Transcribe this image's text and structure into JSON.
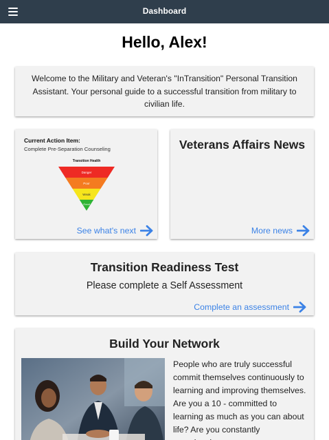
{
  "header": {
    "title": "Dashboard",
    "menu_icon": "hamburger-menu-icon"
  },
  "greeting": "Hello, Alex!",
  "welcome": {
    "text": "Welcome to the Military and Veteran's \"InTransition\" Personal Transition Assistant. Your personal guide to a successful transition from military to civilian life."
  },
  "action_item": {
    "title": "Current Action Item:",
    "subtitle": "Complete Pre-Separation Counseling",
    "chart": {
      "title": "Transition Health",
      "levels": [
        {
          "label": "Danger",
          "color": "#ee2a24"
        },
        {
          "label": "Poor",
          "color": "#f47b20"
        },
        {
          "label": "Weak",
          "color": "#f6e51c"
        },
        {
          "label": "Good",
          "color": "#2fb433"
        }
      ]
    },
    "link": "See what's next"
  },
  "news": {
    "title": "Veterans Affairs News",
    "link": "More news"
  },
  "readiness": {
    "title": "Transition Readiness Test",
    "subtitle": "Please complete a Self Assessment",
    "link": "Complete an assessment"
  },
  "network": {
    "title": "Build Your Network",
    "photo": "business-team-meeting-photo",
    "text": "People who are truly successful commit themselves continuously to learning and improving themselves. Are you a 10 - committed to learning as much as you can about life? Are you constantly experiencing new"
  },
  "colors": {
    "header_bg": "#2f3e4c",
    "link": "#3b82e6",
    "card_bg": "#f2f2f2"
  },
  "icons": {
    "link_arrow": "arrow-right-icon"
  }
}
